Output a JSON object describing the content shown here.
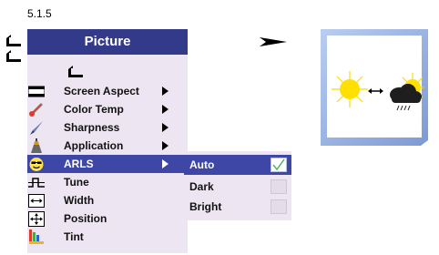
{
  "section_number": "5.1.5",
  "menu": {
    "title": "Picture",
    "items": [
      {
        "label": "Screen Aspect",
        "icon": "screen-aspect-icon",
        "has_submenu": true
      },
      {
        "label": "Color Temp",
        "icon": "thermometer-icon",
        "has_submenu": true
      },
      {
        "label": "Sharpness",
        "icon": "sharpness-icon",
        "has_submenu": true
      },
      {
        "label": "Application",
        "icon": "application-icon",
        "has_submenu": true
      },
      {
        "label": "ARLS",
        "icon": "sunglasses-face-icon",
        "has_submenu": true,
        "selected": true
      },
      {
        "label": "Tune",
        "icon": "tune-icon",
        "has_submenu": false
      },
      {
        "label": "Width",
        "icon": "width-icon",
        "has_submenu": false
      },
      {
        "label": "Position",
        "icon": "position-icon",
        "has_submenu": false
      },
      {
        "label": "Tint",
        "icon": "tint-icon",
        "has_submenu": false
      }
    ]
  },
  "submenu": {
    "options": [
      {
        "label": "Auto",
        "checked": true
      },
      {
        "label": "Dark",
        "checked": false
      },
      {
        "label": "Bright",
        "checked": false
      }
    ]
  },
  "colors": {
    "menu_background": "#ede6f2",
    "title_bar": "#333a8a",
    "selection": "#3f47a6",
    "checkmark": "#3fae4a"
  }
}
